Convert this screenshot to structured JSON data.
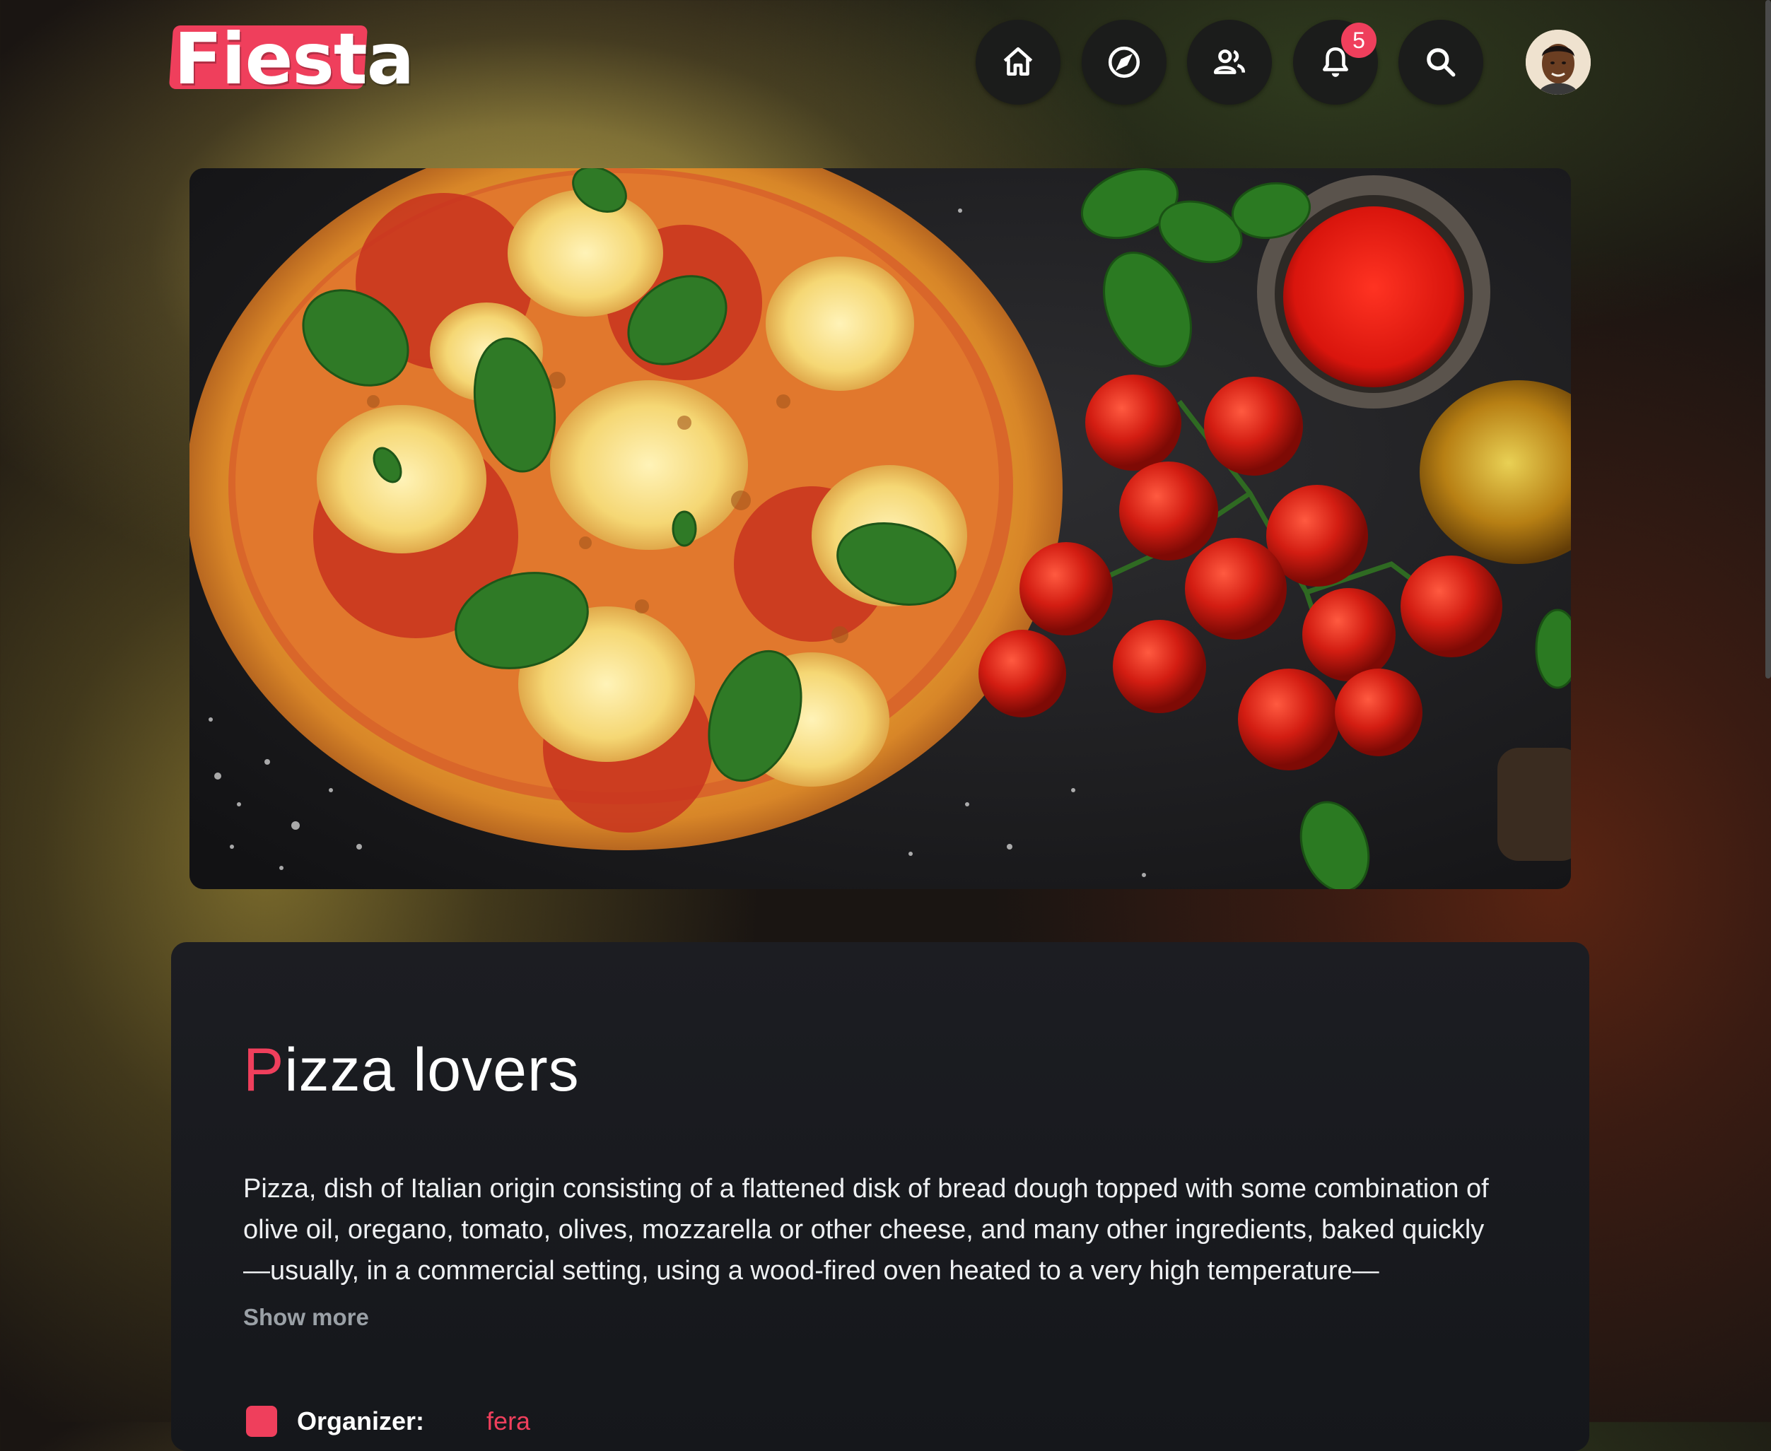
{
  "app": {
    "logo_text": "Fiesta"
  },
  "nav": {
    "items": [
      {
        "name": "home",
        "icon": "home-icon"
      },
      {
        "name": "explore",
        "icon": "compass-icon"
      },
      {
        "name": "people",
        "icon": "people-icon"
      },
      {
        "name": "notifications",
        "icon": "bell-icon",
        "badge": "5"
      },
      {
        "name": "search",
        "icon": "search-icon"
      }
    ],
    "avatar_icon": "user-avatar"
  },
  "hero": {
    "image": "pizza-with-basil-tomatoes-photo"
  },
  "group": {
    "title_first_letter": "P",
    "title_rest": "izza lovers",
    "description": "Pizza, dish of Italian origin consisting of a flattened disk of bread dough topped with some combination of olive oil, oregano, tomato, olives, mozzarella or other cheese, and many other ingredients, baked quickly—usually, in a commercial setting, using a wood-fired oven heated to a very high temperature—",
    "show_more_label": "Show more",
    "organizer_label": "Organizer:",
    "organizer_name": "fera"
  },
  "colors": {
    "accent": "#ef3f5c",
    "card_bg": "#1c1d22",
    "nav_bg": "#1b1c1b"
  }
}
